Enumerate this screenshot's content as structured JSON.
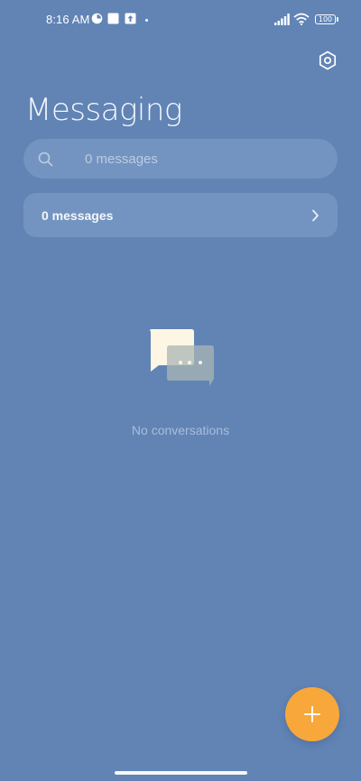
{
  "status_bar": {
    "time": "8:16 AM",
    "icons": [
      "data-saver-icon",
      "square-notification-icon",
      "upload-notification-icon"
    ],
    "battery": "100"
  },
  "header": {
    "title": "Messaging",
    "settings_icon": "settings-hexagon-icon"
  },
  "search": {
    "placeholder": "0 messages",
    "value": "",
    "icon": "search-icon"
  },
  "messages_card": {
    "label": "0 messages",
    "icon": "chevron-right-icon"
  },
  "empty_state": {
    "text": "No conversations",
    "icon": "chat-bubbles-icon"
  },
  "fab": {
    "icon": "plus-icon"
  },
  "colors": {
    "background": "#6184b5",
    "card": "#7394c0",
    "accent": "#f8a73a"
  }
}
